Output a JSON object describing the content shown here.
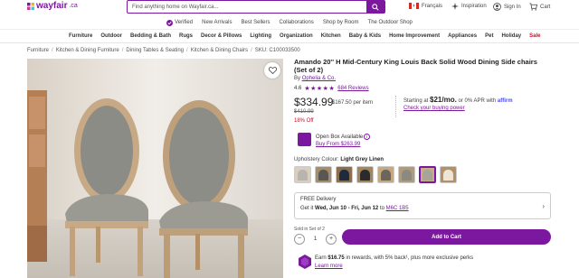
{
  "header": {
    "logo_text": "wayfair",
    "logo_suffix": ".ca",
    "search_placeholder": "Find anything home on Wayfair.ca...",
    "language": "Français",
    "inspiration": "Inspiration",
    "sign_in": "Sign In",
    "cart": "Cart"
  },
  "subnav": {
    "verified": "Verified",
    "links": [
      "New Arrivals",
      "Best Sellers",
      "Collaborations",
      "Shop by Room",
      "The Outdoor Shop"
    ]
  },
  "nav": {
    "items": [
      "Furniture",
      "Outdoor",
      "Bedding & Bath",
      "Rugs",
      "Decor & Pillows",
      "Lighting",
      "Organization",
      "Kitchen",
      "Baby & Kids",
      "Home Improvement",
      "Appliances",
      "Pet",
      "Holiday"
    ],
    "sale": "Sale"
  },
  "breadcrumb": {
    "items": [
      "Furniture",
      "Kitchen & Dining Furniture",
      "Dining Tables & Seating",
      "Kitchen & Dining Chairs"
    ],
    "sku": "SKU: C100033500"
  },
  "product": {
    "title": "Amando 20'' H Mid-Century King Louis Back Solid Wood Dining Side chairs (Set of 2)",
    "brand_prefix": "By",
    "brand": "Ophelia & Co.",
    "rating": "4.6",
    "stars": "★★★★★",
    "reviews": "684 Reviews",
    "price": "$334.99",
    "per_unit": "$167.50 per item",
    "was_price": "$410.99",
    "discount": "18% Off"
  },
  "financing": {
    "starting_at": "Starting at",
    "amount": "$21/mo.",
    "apr": "or 0% APR with",
    "affirm": "affirm",
    "link": "Check your buying power"
  },
  "open_box": {
    "label": "Open Box Available",
    "info": "i",
    "link": "Buy From $263.99"
  },
  "upholstery": {
    "label": "Upholstery Colour:",
    "value": "Light Grey Linen",
    "selected_index": 6,
    "swatches": [
      {
        "back": "#b9b4ad",
        "frame": "#d9cfc1"
      },
      {
        "back": "#5a5752",
        "frame": "#a58e6b"
      },
      {
        "back": "#1f2a3c",
        "frame": "#8a6f4e"
      },
      {
        "back": "#2b2b2b",
        "frame": "#a4865d"
      },
      {
        "back": "#6b655c",
        "frame": "#c4a983"
      },
      {
        "back": "#8a8a82",
        "frame": "#b59a76"
      },
      {
        "back": "#a9a49a",
        "frame": "#c7ae8b"
      },
      {
        "back": "#ece5d8",
        "frame": "#b49064"
      }
    ]
  },
  "delivery": {
    "line1": "FREE Delivery",
    "line2_prefix": "Get it",
    "line2_dates": "Wed, Jun 10 - Fri, Jun 12",
    "line2_to": "to",
    "zip": "M6C 1B5",
    "chevron": "›"
  },
  "purchase": {
    "set_label": "Sold in Set of 2",
    "qty": "1",
    "minus": "−",
    "plus": "+",
    "add_to_cart": "Add to Cart"
  },
  "rewards": {
    "text_prefix": "Earn",
    "amount": "$16.75",
    "text_suffix": "in rewards, with 5% back¹, plus more exclusive perks",
    "link": "Learn more"
  },
  "colors": {
    "brand": "#7b189f",
    "sale": "#c8102e"
  }
}
